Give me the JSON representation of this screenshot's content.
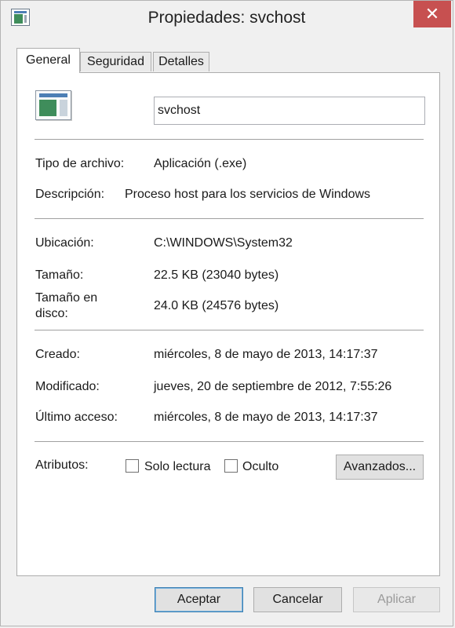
{
  "window": {
    "title": "Propiedades: svchost",
    "close_glyph": "✕"
  },
  "tabs": [
    {
      "label": "General",
      "active": true
    },
    {
      "label": "Seguridad",
      "active": false
    },
    {
      "label": "Detalles",
      "active": false
    }
  ],
  "general": {
    "file_name": "svchost",
    "file_type": {
      "label": "Tipo de archivo:",
      "value": "Aplicación (.exe)"
    },
    "description": {
      "label": "Descripción:",
      "value": "Proceso host para los servicios de Windows"
    },
    "location": {
      "label": "Ubicación:",
      "value": "C:\\WINDOWS\\System32"
    },
    "size": {
      "label": "Tamaño:",
      "value": "22.5 KB (23040 bytes)"
    },
    "size_on_disk": {
      "label_line1": "Tamaño en",
      "label_line2": "disco:",
      "value": "24.0 KB (24576 bytes)"
    },
    "created": {
      "label": "Creado:",
      "value": "miércoles, 8 de mayo de 2013, 14:17:37"
    },
    "modified": {
      "label": "Modificado:",
      "value": "jueves, 20 de septiembre de 2012, 7:55:26"
    },
    "accessed": {
      "label": "Último acceso:",
      "value": "miércoles, 8 de mayo de 2013, 14:17:37"
    },
    "attributes": {
      "label": "Atributos:",
      "read_only_label": "Solo lectura",
      "read_only_checked": false,
      "hidden_label": "Oculto",
      "hidden_checked": false,
      "advanced_label": "Avanzados..."
    }
  },
  "buttons": {
    "ok": "Aceptar",
    "cancel": "Cancelar",
    "apply": "Aplicar",
    "apply_enabled": false
  },
  "colors": {
    "close_button": "#c75050",
    "default_button_border": "#3c7fb1"
  },
  "icons": {
    "title": "application-window-icon",
    "file": "executable-file-icon",
    "close": "close-icon"
  }
}
